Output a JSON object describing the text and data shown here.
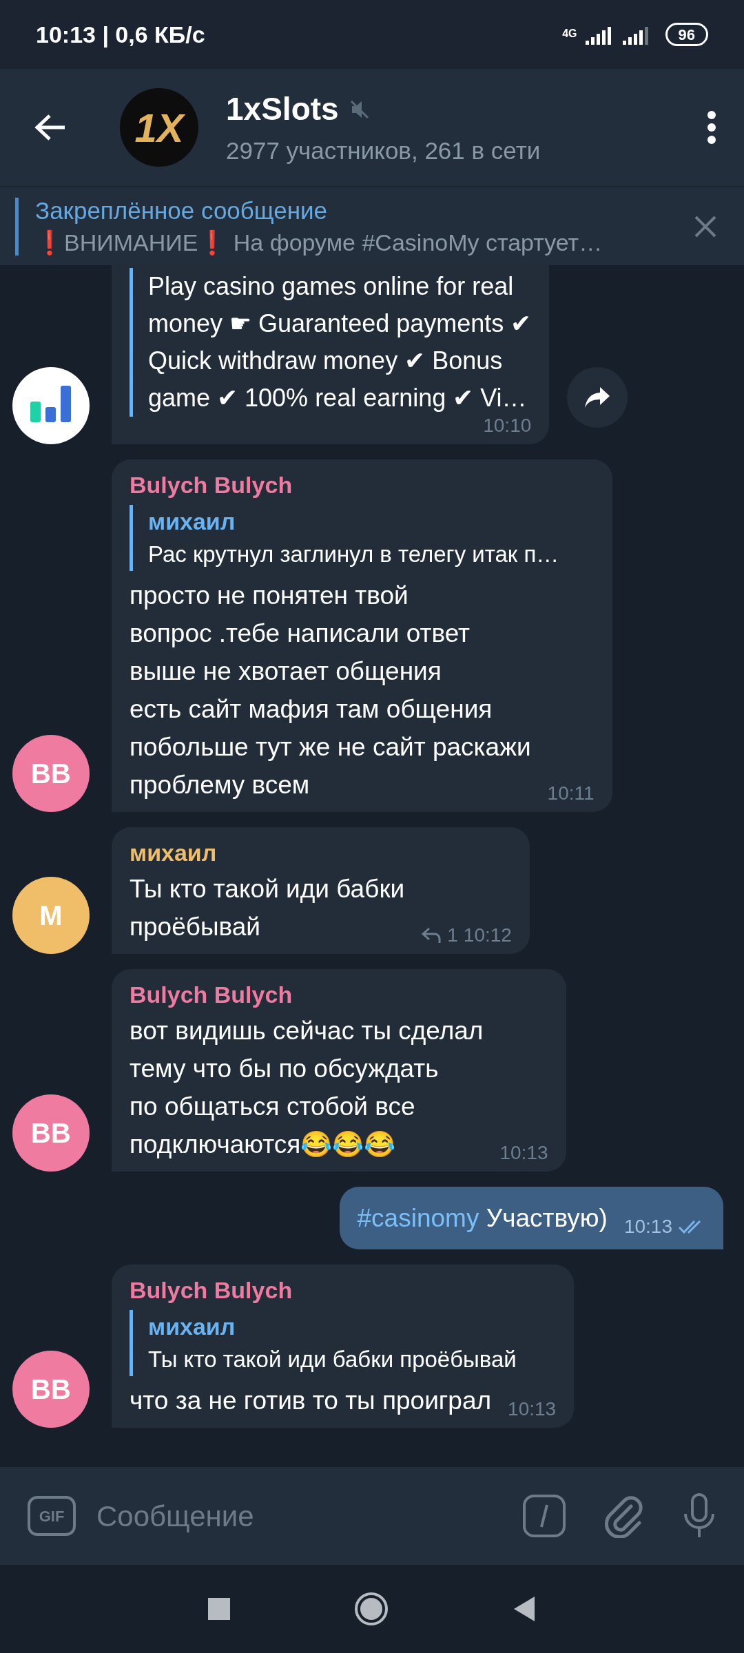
{
  "status_bar": {
    "time": "10:13 | 0,6 КБ/с",
    "network": "4G",
    "battery": "96"
  },
  "header": {
    "logo_text": "1X",
    "title": "1xSlots",
    "muted": true,
    "subtitle": "2977 участников, 261 в сети"
  },
  "pinned": {
    "title": "Закреплённое сообщение",
    "text": "❗ВНИМАНИЕ❗ На форуме #CasinoMy стартует…"
  },
  "messages": [
    {
      "kind": "incoming",
      "avatar": {
        "kind": "chart"
      },
      "preview_text": "Play casino games online for real\nmoney ☛ Guaranteed payments ✔\nQuick withdraw money ✔ Bonus\ngame ✔ 100% real earning ✔ Vi…",
      "time": "10:10",
      "share": true
    },
    {
      "kind": "incoming",
      "avatar": {
        "kind": "initials",
        "initials": "BB"
      },
      "color": "#f07ba0",
      "sender": "Bulych Bulych",
      "reply": {
        "author": "михаил",
        "text": "Рас крутнул заглинул в телегу итак п…"
      },
      "text": "просто не понятен твой\nвопрос .тебе написали ответ\nвыше не хвотает общения\nесть сайт мафия там общения\nпобольше тут же не сайт раскажи\nпроблему всем",
      "time": "10:11"
    },
    {
      "kind": "incoming",
      "avatar": {
        "kind": "initials",
        "initials": "M"
      },
      "color": "#f0bd68",
      "sender": "михаил",
      "text": "Ты кто такой иди бабки\nпроёбывай",
      "replies": "1",
      "time": "10:12"
    },
    {
      "kind": "incoming",
      "avatar": {
        "kind": "initials",
        "initials": "BB"
      },
      "color": "#f07ba0",
      "sender": "Bulych Bulych",
      "text": "вот видишь сейчас ты сделал\nтему что бы по обсуждать\nпо общаться стобой все\nподключаются😂😂😂",
      "time": "10:13"
    },
    {
      "kind": "outgoing",
      "hashtag": "#casinomy",
      "text": "Участвую)",
      "time": "10:13",
      "read": true
    },
    {
      "kind": "incoming",
      "avatar": {
        "kind": "initials",
        "initials": "BB"
      },
      "color": "#f07ba0",
      "sender": "Bulych Bulych",
      "reply": {
        "author": "михаил",
        "text": "Ты кто такой иди бабки проёбывай"
      },
      "text": "что за не готив то ты проиграл",
      "time": "10:13"
    }
  ],
  "composer": {
    "gif_label": "GIF",
    "placeholder": "Сообщение"
  }
}
